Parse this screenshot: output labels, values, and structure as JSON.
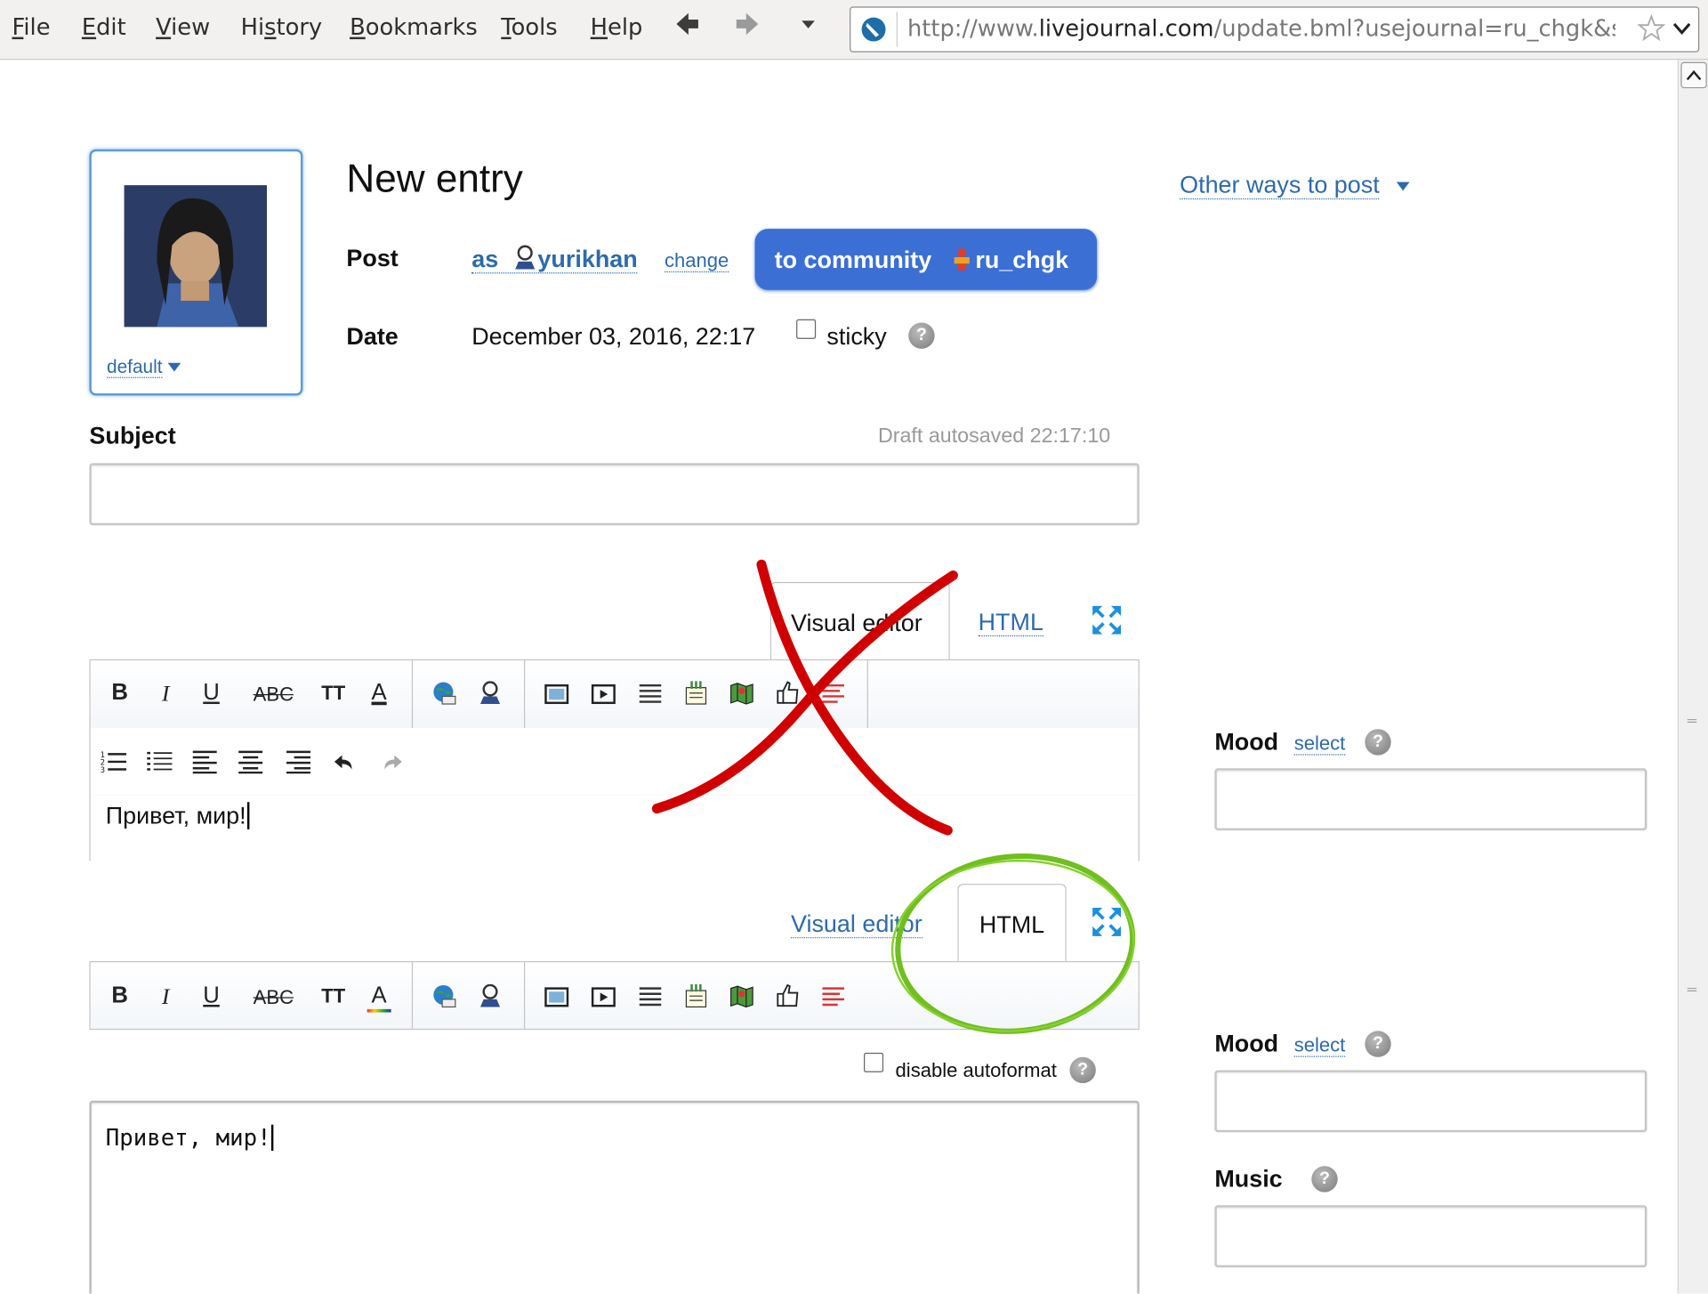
{
  "browser": {
    "menu": [
      "File",
      "Edit",
      "View",
      "History",
      "Bookmarks",
      "Tools",
      "Help"
    ],
    "url_prefix": "http://www.",
    "url_domain": "livejournal.com",
    "url_rest": "/update.bml?usejournal=ru_chgk&style="
  },
  "page": {
    "title": "New entry",
    "other_ways": "Other ways to post",
    "userpic_label": "default",
    "post_label": "Post",
    "as_text": "as",
    "username": "yurikhan",
    "change_link": "change",
    "community_prefix": "to community",
    "community_name": "ru_chgk",
    "date_label": "Date",
    "date_value": "December 03, 2016, 22:17",
    "sticky_label": "sticky",
    "subject_label": "Subject",
    "draft_status": "Draft autosaved 22:17:10",
    "subject_value": ""
  },
  "editor1": {
    "tab_visual": "Visual editor",
    "tab_html": "HTML",
    "body_text": "Привет, мир!"
  },
  "editor2": {
    "tab_visual": "Visual editor",
    "tab_html": "HTML",
    "disable_autoformat": "disable autoformat",
    "body_text": "Привет, мир!"
  },
  "toolbar": {
    "bold": "B",
    "italic": "I",
    "underline": "U",
    "strike": "ABC",
    "size": "TT",
    "color": "A"
  },
  "sidebar": {
    "mood_label": "Mood",
    "mood_select": "select",
    "music_label": "Music"
  },
  "colors": {
    "accent": "#2d6aad",
    "community_btn": "#3b6fd4",
    "annotation_red": "#d00000",
    "annotation_green": "#6fbf1f"
  }
}
